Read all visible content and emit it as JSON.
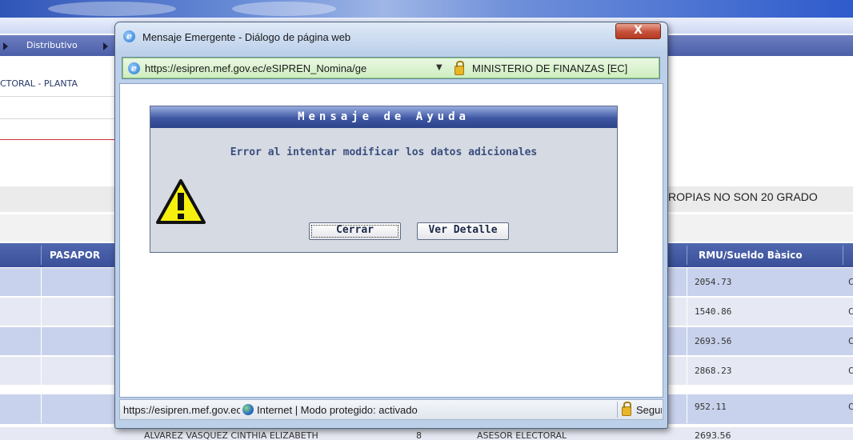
{
  "background_page": {
    "menu": {
      "item": "Distributivo"
    },
    "breadcrumb": "CTORAL - PLANTA",
    "notice": "ROPIAS NO SON 20 GRADO",
    "table": {
      "headers": {
        "pasaporte": "PASAPOR",
        "rmu": "RMU/Sueldo Bàsico"
      },
      "rows": [
        {
          "rmu": "2054.73",
          "next": "C"
        },
        {
          "rmu": "1540.86",
          "next": "C"
        },
        {
          "rmu": "2693.56",
          "next": "C"
        },
        {
          "rmu": "2868.23",
          "next": "C"
        },
        {
          "rmu": "952.11",
          "next": "C"
        }
      ],
      "partial_row": {
        "name": "ALVAREZ VASQUEZ CINTHIA ELIZABETH",
        "num": "8",
        "cargo": "ASESOR ELECTORAL",
        "rmu": "2693.56"
      }
    }
  },
  "popup": {
    "title": "Mensaje Emergente - Diálogo de página web",
    "close_label": "X",
    "address": {
      "url": "https://esipren.mef.gov.ec/eSIPREN_Nomina/ge",
      "dropdown": "▼",
      "certificate": "MINISTERIO DE FINANZAS [EC]"
    },
    "message": {
      "header": "Mensaje de Ayuda",
      "text": "Error al intentar modificar los datos adicionales",
      "buttons": {
        "close": "Cerrar",
        "detail": "Ver Detalle"
      }
    },
    "status": {
      "url": "https://esipren.mef.gov.ec",
      "zone": "Internet | Modo protegido: activado",
      "security": "Seguridad"
    },
    "icons": [
      "ie-icon",
      "lock-icon",
      "warning-icon",
      "globe-icon",
      "close-icon"
    ]
  }
}
